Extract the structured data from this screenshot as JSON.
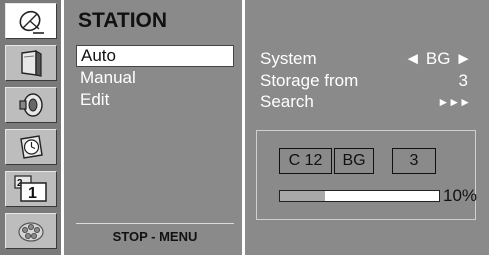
{
  "icon_bar": {
    "items": [
      {
        "name": "satellite-dish-icon",
        "selected": true
      },
      {
        "name": "picture-frame-icon",
        "selected": false
      },
      {
        "name": "speaker-icon",
        "selected": false
      },
      {
        "name": "clock-icon",
        "selected": false
      },
      {
        "name": "tv-channel-icon",
        "selected": false,
        "label": "1",
        "sub_label": "2"
      },
      {
        "name": "stop-gear-icon",
        "selected": false
      }
    ]
  },
  "menu": {
    "title": "STATION",
    "items": [
      {
        "label": "Auto",
        "selected": true
      },
      {
        "label": "Manual",
        "selected": false
      },
      {
        "label": "Edit",
        "selected": false
      }
    ],
    "footer": "STOP - MENU"
  },
  "settings": {
    "rows": [
      {
        "label": "System",
        "value": "◄ BG ►"
      },
      {
        "label": "Storage from",
        "value": "3"
      },
      {
        "label": "Search",
        "value": "►►►"
      }
    ],
    "status": {
      "channel": "C 12",
      "system": "BG",
      "program": "3",
      "progress_pct": 10,
      "progress_text": "10%"
    }
  },
  "colors": {
    "panel_bg": "#8a8a8a",
    "icon_bar_bg": "#7a7a7a",
    "selected_bg": "#ffffff",
    "text_light": "#ffffff",
    "text_dark": "#111111"
  }
}
